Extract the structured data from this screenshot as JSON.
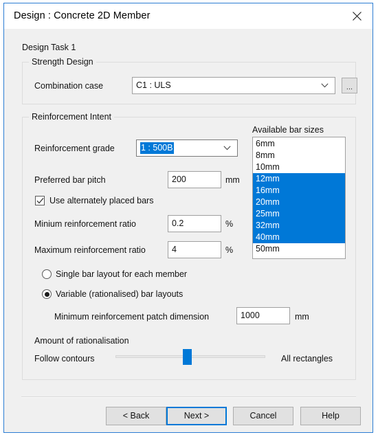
{
  "window": {
    "title": "Design : Concrete 2D Member",
    "close_icon": "close-icon"
  },
  "body": {
    "task_label": "Design Task 1"
  },
  "strength_design": {
    "group_title": "Strength Design",
    "combination_case_label": "Combination case",
    "combination_case_value": "C1 : ULS",
    "browse_button_label": "...",
    "dropdown_icon": "chevron-down-icon"
  },
  "reinforcement_intent": {
    "group_title": "Reinforcement Intent",
    "grade_label": "Reinforcement grade",
    "grade_value": "1 : 500B",
    "grade_dropdown_icon": "chevron-down-icon",
    "bar_pitch_label": "Preferred bar pitch",
    "bar_pitch_value": "200",
    "bar_pitch_unit": "mm",
    "alternate_bars_label": "Use alternately placed bars",
    "alternate_bars_checked": true,
    "min_ratio_label": "Minium reinforcement ratio",
    "min_ratio_value": "0.2",
    "min_ratio_unit": "%",
    "max_ratio_label": "Maximum reinforcement ratio",
    "max_ratio_value": "4",
    "max_ratio_unit": "%",
    "bar_sizes": {
      "label": "Available bar sizes",
      "items": [
        {
          "label": "6mm",
          "selected": false
        },
        {
          "label": "8mm",
          "selected": false
        },
        {
          "label": "10mm",
          "selected": false
        },
        {
          "label": "12mm",
          "selected": true
        },
        {
          "label": "16mm",
          "selected": true
        },
        {
          "label": "20mm",
          "selected": true
        },
        {
          "label": "25mm",
          "selected": true
        },
        {
          "label": "32mm",
          "selected": true
        },
        {
          "label": "40mm",
          "selected": true
        },
        {
          "label": "50mm",
          "selected": false
        }
      ]
    },
    "layout_options": {
      "single": {
        "label": "Single bar layout for each member",
        "selected": false
      },
      "variable": {
        "label": "Variable (rationalised) bar layouts",
        "selected": true
      }
    },
    "patch_dimension_label": "Minimum reinforcement patch dimension",
    "patch_dimension_value": "1000",
    "patch_dimension_unit": "mm",
    "rationalisation": {
      "label": "Amount of rationalisation",
      "min_label": "Follow contours",
      "max_label": "All rectangles",
      "value_percent": 48
    }
  },
  "footer": {
    "back_label": "< Back",
    "next_label": "Next >",
    "cancel_label": "Cancel",
    "help_label": "Help"
  },
  "colors": {
    "accent": "#0078d7",
    "dialog_border": "#2b7cd3",
    "surface": "#f0f0f0"
  }
}
